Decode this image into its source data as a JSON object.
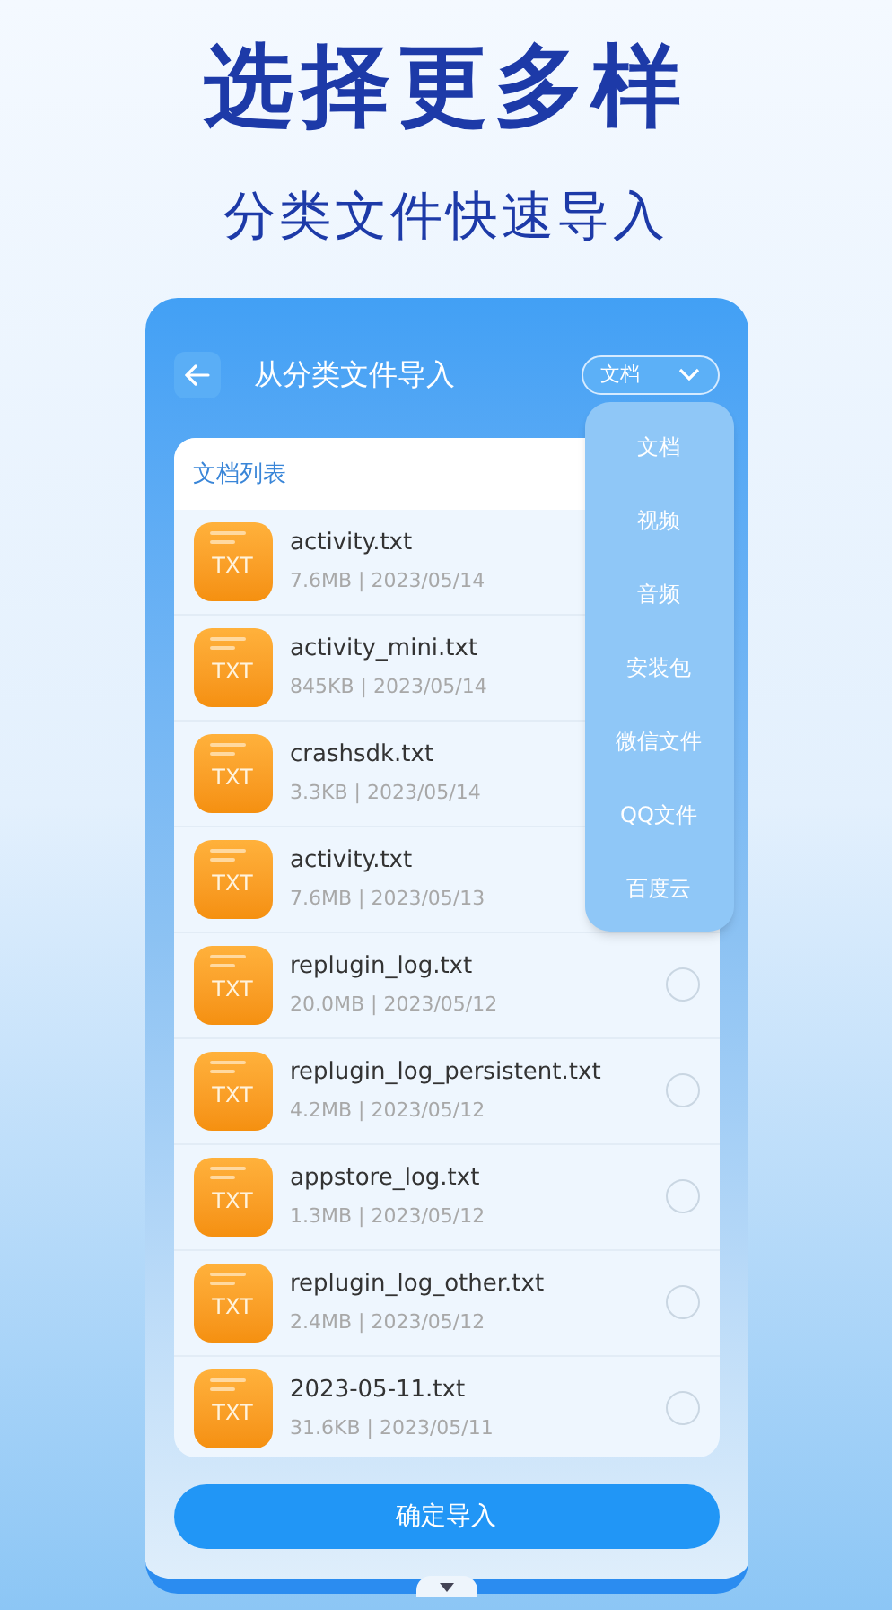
{
  "headline": "选择更多样",
  "subheadline": "分类文件快速导入",
  "screen": {
    "title": "从分类文件导入",
    "filter": {
      "value": "文档",
      "expanded": true
    },
    "menu": [
      "文档",
      "视频",
      "音频",
      "安装包",
      "微信文件",
      "QQ文件",
      "百度云"
    ],
    "list_title": "文档列表",
    "files": [
      {
        "type": "TXT",
        "name": "activity.txt",
        "meta": "7.6MB | 2023/05/14"
      },
      {
        "type": "TXT",
        "name": "activity_mini.txt",
        "meta": "845KB | 2023/05/14"
      },
      {
        "type": "TXT",
        "name": "crashsdk.txt",
        "meta": "3.3KB | 2023/05/14"
      },
      {
        "type": "TXT",
        "name": "activity.txt",
        "meta": "7.6MB | 2023/05/13"
      },
      {
        "type": "TXT",
        "name": "replugin_log.txt",
        "meta": "20.0MB | 2023/05/12",
        "selected": false
      },
      {
        "type": "TXT",
        "name": "replugin_log_persistent.txt",
        "meta": "4.2MB | 2023/05/12",
        "selected": false
      },
      {
        "type": "TXT",
        "name": "appstore_log.txt",
        "meta": "1.3MB | 2023/05/12",
        "selected": false
      },
      {
        "type": "TXT",
        "name": "replugin_log_other.txt",
        "meta": "2.4MB | 2023/05/12",
        "selected": false
      },
      {
        "type": "TXT",
        "name": "2023-05-11.txt",
        "meta": "31.6KB | 2023/05/11",
        "selected": false
      }
    ],
    "confirm_button": "确定导入"
  }
}
